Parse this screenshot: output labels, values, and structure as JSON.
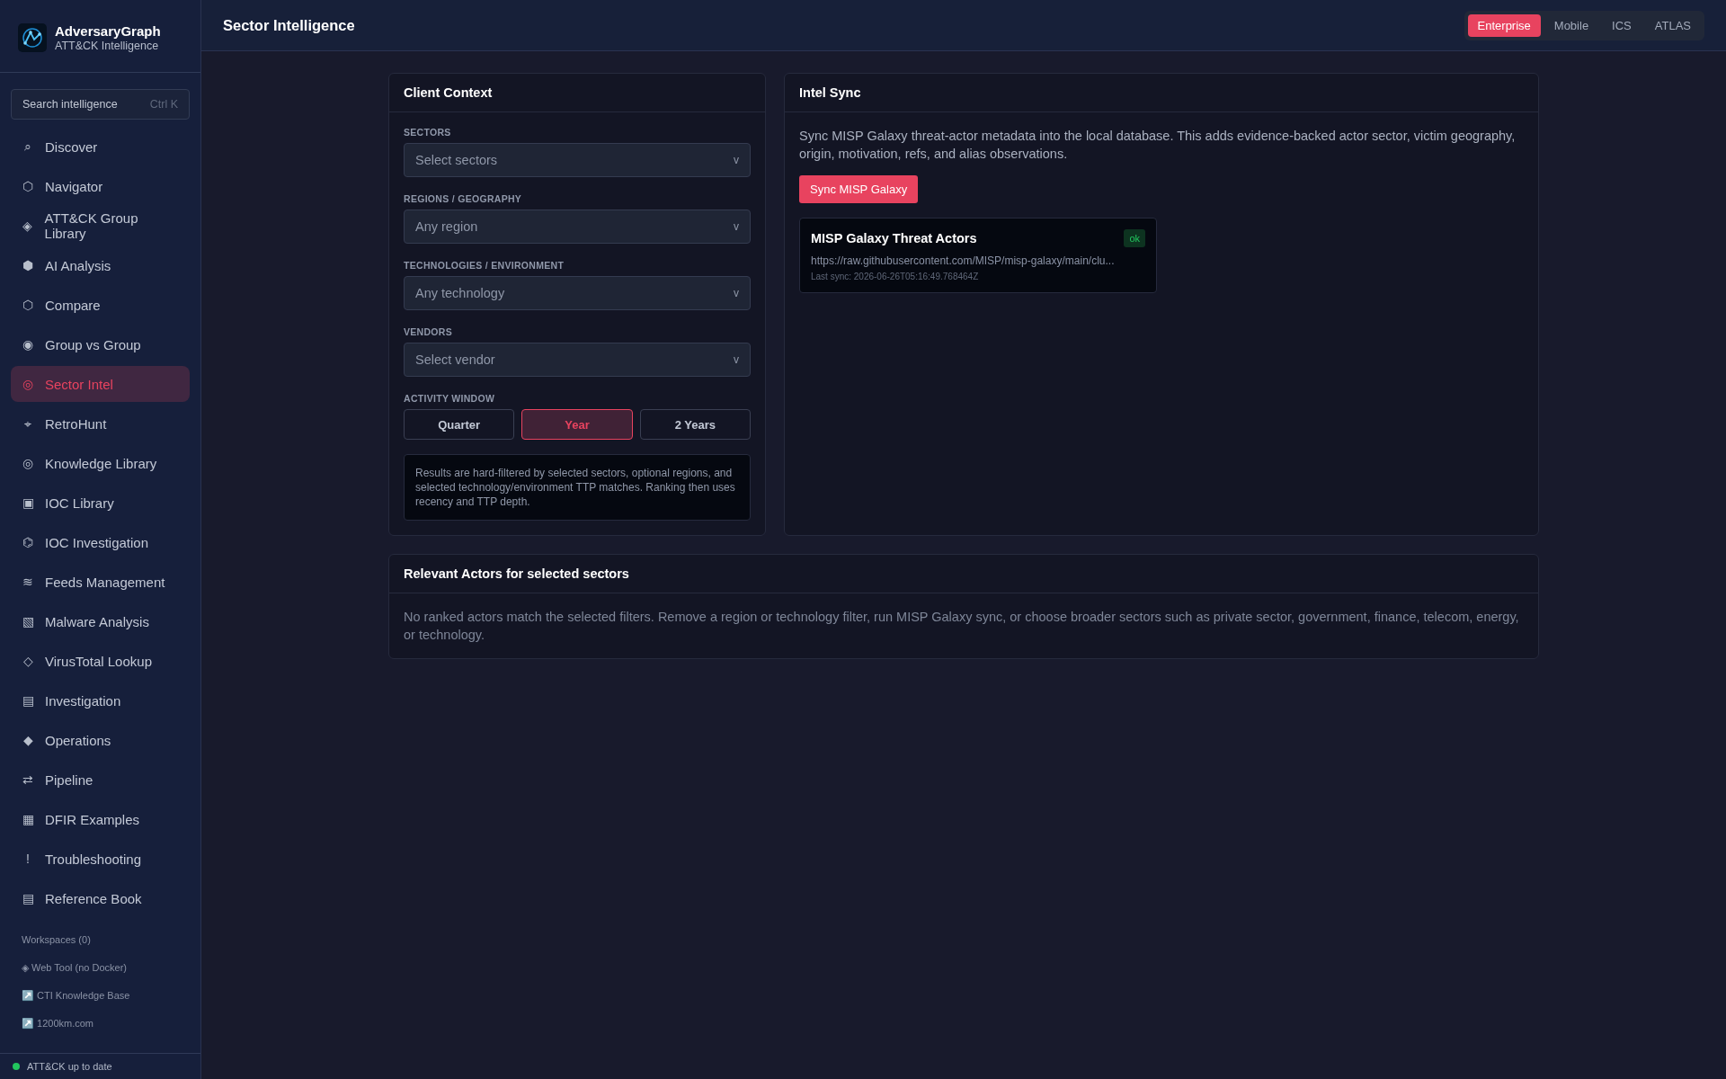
{
  "brand": {
    "name": "AdversaryGraph",
    "subtitle": "ATT&CK Intelligence"
  },
  "search": {
    "placeholder": "Search intelligence",
    "shortcut": "Ctrl K"
  },
  "nav": [
    {
      "icon": "⌕",
      "label": "Discover",
      "selected": false
    },
    {
      "icon": "⬡",
      "label": "Navigator",
      "selected": false
    },
    {
      "icon": "◈",
      "label": "ATT&CK Group Library",
      "selected": false
    },
    {
      "icon": "⬢",
      "label": "AI Analysis",
      "selected": false
    },
    {
      "icon": "⬡",
      "label": "Compare",
      "selected": false
    },
    {
      "icon": "◉",
      "label": "Group vs Group",
      "selected": false
    },
    {
      "icon": "◎",
      "label": "Sector Intel",
      "selected": true
    },
    {
      "icon": "⌖",
      "label": "RetroHunt",
      "selected": false
    },
    {
      "icon": "◎",
      "label": "Knowledge Library",
      "selected": false
    },
    {
      "icon": "▣",
      "label": "IOC Library",
      "selected": false
    },
    {
      "icon": "⌬",
      "label": "IOC Investigation",
      "selected": false
    },
    {
      "icon": "≋",
      "label": "Feeds Management",
      "selected": false
    },
    {
      "icon": "▧",
      "label": "Malware Analysis",
      "selected": false
    },
    {
      "icon": "◇",
      "label": "VirusTotal Lookup",
      "selected": false
    },
    {
      "icon": "▤",
      "label": "Investigation",
      "selected": false
    },
    {
      "icon": "◆",
      "label": "Operations",
      "selected": false
    },
    {
      "icon": "⇄",
      "label": "Pipeline",
      "selected": false
    },
    {
      "icon": "▦",
      "label": "DFIR Examples",
      "selected": false
    },
    {
      "icon": "!",
      "label": "Troubleshooting",
      "selected": false
    },
    {
      "icon": "▤",
      "label": "Reference Book",
      "selected": false
    }
  ],
  "workspaces": "Workspaces (0)",
  "links": [
    {
      "icon": "◈",
      "label": "Web Tool (no Docker)"
    },
    {
      "icon": "↗️",
      "label": "CTI Knowledge Base"
    },
    {
      "icon": "↗️",
      "label": "1200km.com"
    }
  ],
  "status": {
    "label": "ATT&CK up to date",
    "color": "#22c55e"
  },
  "header": {
    "title": "Sector Intelligence"
  },
  "matrix_tabs": [
    {
      "label": "Enterprise",
      "selected": true
    },
    {
      "label": "Mobile",
      "selected": false
    },
    {
      "label": "ICS",
      "selected": false
    },
    {
      "label": "ATLAS",
      "selected": false
    }
  ],
  "client_context": {
    "title": "Client Context",
    "fields": [
      {
        "label": "SECTORS",
        "placeholder": "Select sectors",
        "caret": "v"
      },
      {
        "label": "REGIONS / GEOGRAPHY",
        "placeholder": "Any region",
        "caret": "v"
      },
      {
        "label": "TECHNOLOGIES / ENVIRONMENT",
        "placeholder": "Any technology",
        "caret": "v"
      },
      {
        "label": "VENDORS",
        "placeholder": "Select vendor",
        "caret": "v"
      }
    ],
    "activity_label": "ACTIVITY WINDOW",
    "activity_options": [
      {
        "label": "Quarter",
        "selected": false
      },
      {
        "label": "Year",
        "selected": true
      },
      {
        "label": "2 Years",
        "selected": false
      }
    ],
    "note": "Results are hard-filtered by selected sectors, optional regions, and selected technology/environment TTP matches. Ranking then uses recency and TTP depth."
  },
  "intel_sync": {
    "title": "Intel Sync",
    "description": "Sync MISP Galaxy threat-actor metadata into the local database. This adds evidence-backed actor sector, victim geography, origin, motivation, refs, and alias observations.",
    "button": "Sync MISP Galaxy",
    "sources": [
      {
        "name": "MISP Galaxy Threat Actors",
        "status": "ok",
        "url": "https://raw.githubusercontent.com/MISP/misp-galaxy/main/clu...",
        "last_sync": "Last sync: 2026-06-26T05:16:49.768464Z"
      }
    ]
  },
  "relevant_actors": {
    "title": "Relevant Actors for selected sectors",
    "empty_message": "No ranked actors match the selected filters. Remove a region or technology filter, run MISP Galaxy sync, or choose broader sectors such as private sector, government, finance, telecom, energy, or technology."
  }
}
